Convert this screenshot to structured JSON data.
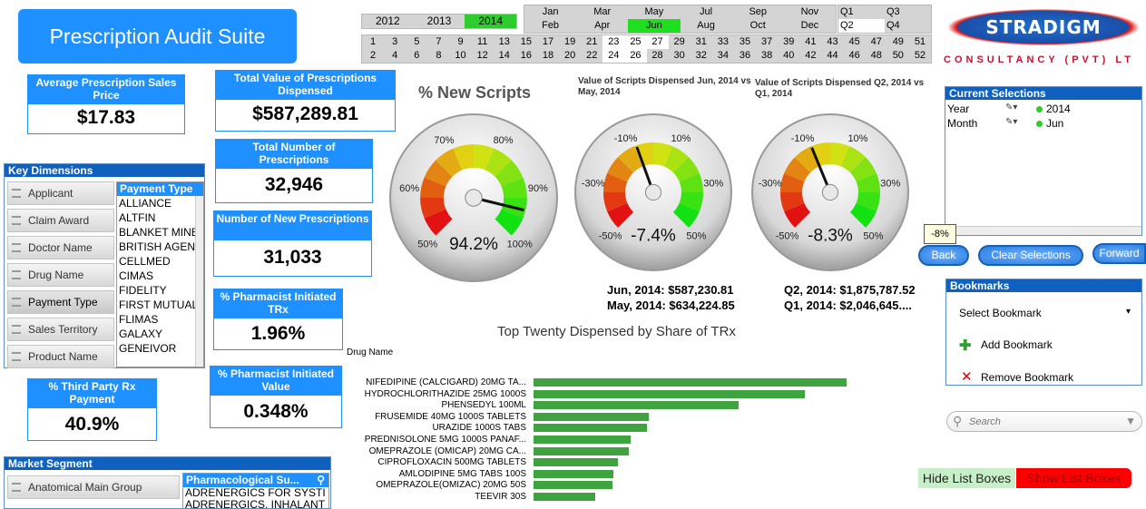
{
  "app": {
    "title": "Prescription Audit Suite"
  },
  "years": [
    {
      "label": "2012",
      "selected": false
    },
    {
      "label": "2013",
      "selected": false
    },
    {
      "label": "2014",
      "selected": true
    }
  ],
  "months": [
    {
      "label": "Jan",
      "selected": false
    },
    {
      "label": "Mar",
      "selected": false
    },
    {
      "label": "May",
      "selected": false
    },
    {
      "label": "Jul",
      "selected": false
    },
    {
      "label": "Sep",
      "selected": false
    },
    {
      "label": "Nov",
      "selected": false
    },
    {
      "label": "Feb",
      "selected": false
    },
    {
      "label": "Apr",
      "selected": false
    },
    {
      "label": "Jun",
      "selected": true
    },
    {
      "label": "Aug",
      "selected": false
    },
    {
      "label": "Oct",
      "selected": false
    },
    {
      "label": "Dec",
      "selected": false
    }
  ],
  "quarters": [
    {
      "label": "Q1",
      "selected": false
    },
    {
      "label": "Q3",
      "selected": false
    },
    {
      "label": "Q2",
      "selected": true
    },
    {
      "label": "Q4",
      "selected": false
    }
  ],
  "weeks_row1": [
    "1",
    "3",
    "5",
    "7",
    "9",
    "11",
    "13",
    "15",
    "17",
    "19",
    "21",
    "23",
    "25",
    "27",
    "29",
    "31",
    "33",
    "35",
    "37",
    "39",
    "41",
    "43",
    "45",
    "47",
    "49",
    "51"
  ],
  "weeks_row2": [
    "2",
    "4",
    "6",
    "8",
    "10",
    "12",
    "14",
    "16",
    "18",
    "20",
    "22",
    "24",
    "26",
    "28",
    "30",
    "32",
    "34",
    "36",
    "38",
    "40",
    "42",
    "44",
    "46",
    "48",
    "50",
    "52"
  ],
  "weeks_selected": [
    "23",
    "25",
    "27",
    "24",
    "26"
  ],
  "logo": {
    "name": "STRADIGM",
    "tagline": "CONSULTANCY (PVT) LT"
  },
  "kpis": {
    "avg_price": {
      "label": "Average Prescription Sales Price",
      "value": "$17.83"
    },
    "total_value": {
      "label": "Total Value of Prescriptions Dispensed",
      "value": "$587,289.81"
    },
    "total_number": {
      "label": "Total Number of Prescriptions",
      "value": "32,946"
    },
    "new_number": {
      "label": "Number of New Prescriptions",
      "value": "31,033"
    },
    "pharm_trx": {
      "label": "% Pharmacist Initiated TRx",
      "value": "1.96%"
    },
    "pharm_value": {
      "label": "% Pharmacist Initiated Value",
      "value": "0.348%"
    },
    "third_party": {
      "label": "% Third Party Rx Payment",
      "value": "40.9%"
    }
  },
  "key_dimensions": {
    "title": "Key Dimensions",
    "buttons": [
      "Applicant",
      "Claim Award",
      "Doctor Name",
      "Drug Name",
      "Payment Type",
      "Sales Territory",
      "Product Name"
    ],
    "active": "Payment Type",
    "list_header": "Payment Type",
    "list_items": [
      "ALLIANCE",
      "ALTFIN",
      "BLANKET MINES",
      "BRITISH AGENC",
      "CELLMED",
      "CIMAS",
      "FIDELITY",
      "FIRST MUTUAL",
      "FLIMAS",
      "GALAXY",
      "GENEIVOR"
    ]
  },
  "market_segment": {
    "title": "Market Segment",
    "button": "Anatomical Main Group",
    "list_header": "Pharmacological Su...",
    "list_items": [
      "ADRENERGICS FOR SYSTI",
      "ADRENERGICS, INHALANT"
    ]
  },
  "gauges": [
    {
      "title": "% New Scripts",
      "value": 94.2,
      "display": "94.2%",
      "min": 50,
      "max": 100,
      "ticks": [
        "50%",
        "60%",
        "70%",
        "80%",
        "90%",
        "100%"
      ],
      "footer": []
    },
    {
      "title": "Value of Scripts Dispensed Jun, 2014 vs May, 2014",
      "value": -7.4,
      "display": "-7.4%",
      "min": -50,
      "max": 50,
      "ticks": [
        "-50%",
        "-30%",
        "-10%",
        "10%",
        "30%",
        "50%"
      ],
      "footer": [
        "Jun, 2014: $587,230.81",
        "May, 2014: $634,224.85"
      ]
    },
    {
      "title": "Value of Scripts Dispensed Q2, 2014 vs Q1, 2014",
      "value": -8.3,
      "display": "-8.3%",
      "min": -50,
      "max": 50,
      "ticks": [
        "-50%",
        "-30%",
        "-10%",
        "10%",
        "30%",
        "50%"
      ],
      "footer": [
        "Q2, 2014: $1,875,787.52",
        "Q1, 2014: $2,046,645...."
      ]
    }
  ],
  "current_selections": {
    "title": "Current Selections",
    "rows": [
      {
        "field": "Year",
        "value": "2014"
      },
      {
        "field": "Month",
        "value": "Jun"
      }
    ]
  },
  "nav": {
    "tooltip": "-8%",
    "back": "Back",
    "clear": "Clear Selections",
    "forward": "Forward"
  },
  "bookmarks": {
    "title": "Bookmarks",
    "select": "Select Bookmark",
    "add": "Add Bookmark",
    "remove": "Remove Bookmark"
  },
  "search": {
    "placeholder": "Search"
  },
  "toggles": {
    "hide": "Hide List Boxes",
    "show": "Show List Boxes"
  },
  "colors": {
    "accent": "#1e90ff",
    "selected": "#2ecc2e",
    "bar": "#3fa33f",
    "show_btn": "#ff0000"
  },
  "chart_data": {
    "type": "bar",
    "title": "Top Twenty Dispensed by Share of TRx",
    "ylabel": "Drug Name",
    "categories": [
      "NIFEDIPINE (CALCIGARD) 20MG TA...",
      "HYDROCHLORITHAZIDE 25MG 1000S",
      "PHENSEDYL 100ML",
      "FRUSEMIDE 40MG 1000S TABLETS",
      "URAZIDE 1000S TABS",
      "PREDNISOLONE 5MG 1000S PANAF...",
      "OMEPRAZOLE (OMICAP) 20MG CA...",
      "CIPROFLOXACIN 500MG TABLETS",
      "AMLODIPINE 5MG TABS 100S",
      "OMEPRAZOLE(OMIZAC) 20MG 50S",
      "TEEVIR 30S"
    ],
    "values": [
      345,
      299,
      226,
      127,
      125,
      107,
      105,
      93,
      88,
      87,
      68
    ],
    "xlim": [
      0,
      345
    ]
  }
}
